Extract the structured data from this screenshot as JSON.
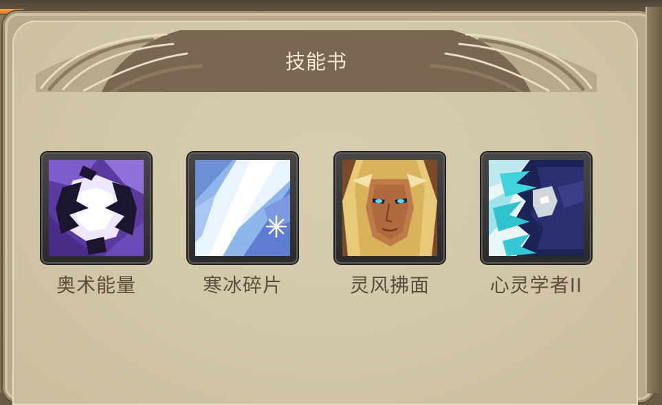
{
  "panel": {
    "title": "技能书"
  },
  "top_bar": {
    "progress_fraction": 0.3
  },
  "skills": [
    {
      "label": "奥术能量",
      "icon": "arcane-energy-icon"
    },
    {
      "label": "寒冰碎片",
      "icon": "frost-shard-icon"
    },
    {
      "label": "灵风拂面",
      "icon": "spirit-wind-icon"
    },
    {
      "label": "心灵学者II",
      "icon": "mind-scholar-icon"
    }
  ],
  "colors": {
    "panel_bg": "#d2c6a8",
    "title_band": "#7a6750",
    "label_text": "#5b4d3c",
    "accent_orange": "#e58a36"
  }
}
